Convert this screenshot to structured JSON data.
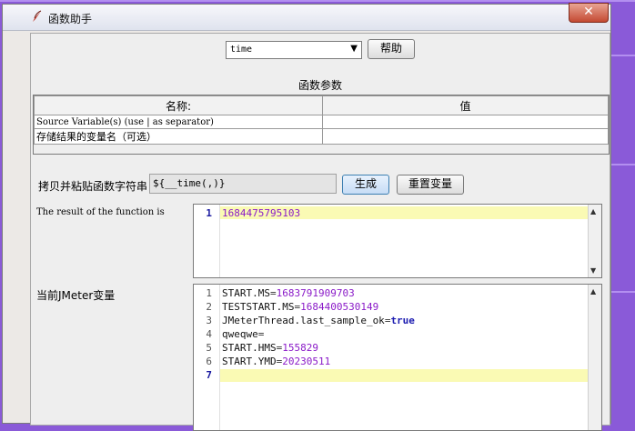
{
  "window": {
    "title": "函数助手",
    "close_glyph": "✕"
  },
  "function_select": {
    "value": "time",
    "arrow": "▼"
  },
  "buttons": {
    "help": "帮助",
    "generate": "生成",
    "reset_vars": "重置变量"
  },
  "params": {
    "title": "函数参数",
    "columns": [
      "名称:",
      "值"
    ],
    "rows": [
      {
        "name": "Source Variable(s) (use | as separator)",
        "value": ""
      },
      {
        "name": "存储结果的变量名（可选）",
        "value": ""
      }
    ]
  },
  "copy": {
    "label": "拷贝并粘贴函数字符串",
    "value": "${__time(,)}"
  },
  "result": {
    "label": "The result of the function is",
    "lines": [
      {
        "num": "1",
        "text": "1684475795103"
      }
    ]
  },
  "jmeter_vars": {
    "label": "当前JMeter变量",
    "lines": [
      {
        "num": "1",
        "key": "START.MS",
        "eq": "=",
        "val": "1683791909703"
      },
      {
        "num": "2",
        "key": "TESTSTART.MS",
        "eq": "=",
        "val": "1684400530149"
      },
      {
        "num": "3",
        "key": "JMeterThread.last_sample_ok",
        "eq": "=",
        "val": "true"
      },
      {
        "num": "4",
        "key": "qweqwe",
        "eq": "=",
        "val": ""
      },
      {
        "num": "5",
        "key": "START.HMS",
        "eq": "=",
        "val": "155829"
      },
      {
        "num": "6",
        "key": "START.YMD",
        "eq": "=",
        "val": "20230511"
      },
      {
        "num": "7",
        "key": "",
        "eq": "",
        "val": ""
      }
    ]
  },
  "colors": {
    "desktop": "#8a5ad8",
    "highlight": "#fafab4",
    "number": "#8a1ac8",
    "keyword": "#1b1bb0"
  }
}
